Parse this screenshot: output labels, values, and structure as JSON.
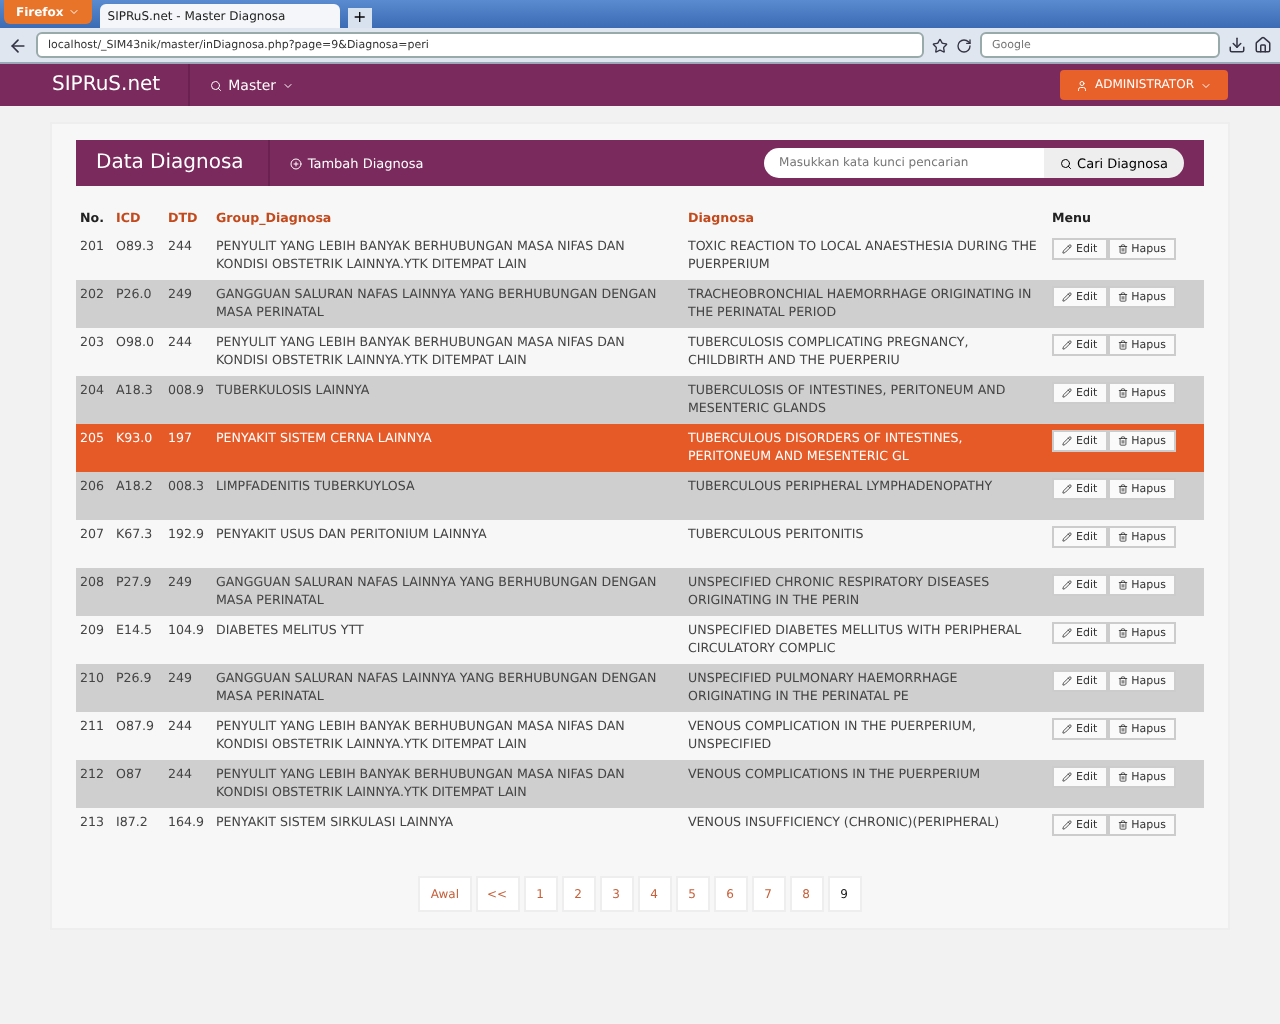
{
  "browser": {
    "menu_button": "Firefox",
    "tab_title": "SIPRuS.net - Master Diagnosa",
    "new_tab": "+",
    "url": "localhost/_SIM43nik/master/inDiagnosa.php?page=9&Diagnosa=peri",
    "search_placeholder": "Google"
  },
  "navbar": {
    "brand": "SIPRuS.net",
    "menu": "Master",
    "user": "ADMINISTRATOR"
  },
  "panel": {
    "title": "Data Diagnosa",
    "add_button": "Tambah Diagnosa",
    "search_placeholder": "Masukkan kata kunci pencarian",
    "search_button": "Cari Diagnosa"
  },
  "table": {
    "columns": [
      "No.",
      "ICD",
      "DTD",
      "Group_Diagnosa",
      "Diagnosa",
      "Menu"
    ],
    "rows": [
      {
        "no": "201",
        "icd": "O89.3",
        "dtd": "244",
        "group": "PENYULIT YANG LEBIH BANYAK BERHUBUNGAN MASA NIFAS DAN KONDISI OBSTETRIK LAINNYA.YTK DITEMPAT LAIN",
        "diagnosa": "TOXIC REACTION TO LOCAL ANAESTHESIA DURING THE PUERPERIUM",
        "selected": false
      },
      {
        "no": "202",
        "icd": "P26.0",
        "dtd": "249",
        "group": "GANGGUAN SALURAN NAFAS LAINNYA YANG BERHUBUNGAN DENGAN MASA PERINATAL",
        "diagnosa": "TRACHEOBRONCHIAL HAEMORRHAGE ORIGINATING IN THE PERINATAL PERIOD",
        "selected": false
      },
      {
        "no": "203",
        "icd": "O98.0",
        "dtd": "244",
        "group": "PENYULIT YANG LEBIH BANYAK BERHUBUNGAN MASA NIFAS DAN KONDISI OBSTETRIK LAINNYA.YTK DITEMPAT LAIN",
        "diagnosa": "TUBERCULOSIS COMPLICATING PREGNANCY, CHILDBIRTH AND THE PUERPERIU",
        "selected": false
      },
      {
        "no": "204",
        "icd": "A18.3",
        "dtd": "008.9",
        "group": "TUBERKULOSIS LAINNYA",
        "diagnosa": "TUBERCULOSIS OF INTESTINES, PERITONEUM AND MESENTERIC GLANDS",
        "selected": false
      },
      {
        "no": "205",
        "icd": "K93.0",
        "dtd": "197",
        "group": "PENYAKIT SISTEM CERNA LAINNYA",
        "diagnosa": "TUBERCULOUS DISORDERS OF INTESTINES, PERITONEUM AND MESENTERIC GL",
        "selected": true
      },
      {
        "no": "206",
        "icd": "A18.2",
        "dtd": "008.3",
        "group": "LIMPFADENITIS TUBERKUYLOSA",
        "diagnosa": "TUBERCULOUS PERIPHERAL LYMPHADENOPATHY",
        "selected": false
      },
      {
        "no": "207",
        "icd": "K67.3",
        "dtd": "192.9",
        "group": "PENYAKIT USUS DAN PERITONIUM LAINNYA",
        "diagnosa": "TUBERCULOUS PERITONITIS",
        "selected": false
      },
      {
        "no": "208",
        "icd": "P27.9",
        "dtd": "249",
        "group": "GANGGUAN SALURAN NAFAS LAINNYA YANG BERHUBUNGAN DENGAN MASA PERINATAL",
        "diagnosa": "UNSPECIFIED CHRONIC RESPIRATORY DISEASES ORIGINATING IN THE PERIN",
        "selected": false
      },
      {
        "no": "209",
        "icd": "E14.5",
        "dtd": "104.9",
        "group": "DIABETES MELITUS YTT",
        "diagnosa": "UNSPECIFIED DIABETES MELLITUS WITH PERIPHERAL CIRCULATORY COMPLIC",
        "selected": false
      },
      {
        "no": "210",
        "icd": "P26.9",
        "dtd": "249",
        "group": "GANGGUAN SALURAN NAFAS LAINNYA YANG BERHUBUNGAN DENGAN MASA PERINATAL",
        "diagnosa": "UNSPECIFIED PULMONARY HAEMORRHAGE ORIGINATING IN THE PERINATAL PE",
        "selected": false
      },
      {
        "no": "211",
        "icd": "O87.9",
        "dtd": "244",
        "group": "PENYULIT YANG LEBIH BANYAK BERHUBUNGAN MASA NIFAS DAN KONDISI OBSTETRIK LAINNYA.YTK DITEMPAT LAIN",
        "diagnosa": "VENOUS COMPLICATION IN THE PUERPERIUM, UNSPECIFIED",
        "selected": false
      },
      {
        "no": "212",
        "icd": "O87",
        "dtd": "244",
        "group": "PENYULIT YANG LEBIH BANYAK BERHUBUNGAN MASA NIFAS DAN KONDISI OBSTETRIK LAINNYA.YTK DITEMPAT LAIN",
        "diagnosa": "VENOUS COMPLICATIONS IN THE PUERPERIUM",
        "selected": false
      },
      {
        "no": "213",
        "icd": "I87.2",
        "dtd": "164.9",
        "group": "PENYAKIT SISTEM SIRKULASI LAINNYA",
        "diagnosa": "VENOUS INSUFFICIENCY (CHRONIC)(PERIPHERAL)",
        "selected": false
      }
    ],
    "actions": [
      [
        "Edit",
        "Hapus"
      ],
      [
        "Edit",
        "Hapus"
      ],
      [
        "Edit",
        "Hapus"
      ],
      [
        "Edit",
        "Hapus"
      ],
      [
        "Edit",
        "Hapus"
      ],
      [
        "Edit",
        "Hapus"
      ],
      [
        "Edit",
        "Hapus"
      ],
      [
        "Edit",
        "Hapus"
      ],
      [
        "Edit",
        "Hapus"
      ],
      [
        "Edit",
        "Hapus"
      ],
      [
        "Edit",
        "Hapus"
      ],
      [
        "Edit",
        "Hapus"
      ],
      [
        "Edit",
        "Hapus"
      ]
    ]
  },
  "pagination": [
    {
      "label": "Awal",
      "selected": false
    },
    {
      "label": "<<",
      "selected": false
    },
    {
      "label": "1",
      "selected": false
    },
    {
      "label": "2",
      "selected": false
    },
    {
      "label": "3",
      "selected": false
    },
    {
      "label": "4",
      "selected": false
    },
    {
      "label": "5",
      "selected": false
    },
    {
      "label": "6",
      "selected": false
    },
    {
      "label": "7",
      "selected": false
    },
    {
      "label": "8",
      "selected": false
    },
    {
      "label": "9",
      "selected": true
    }
  ]
}
